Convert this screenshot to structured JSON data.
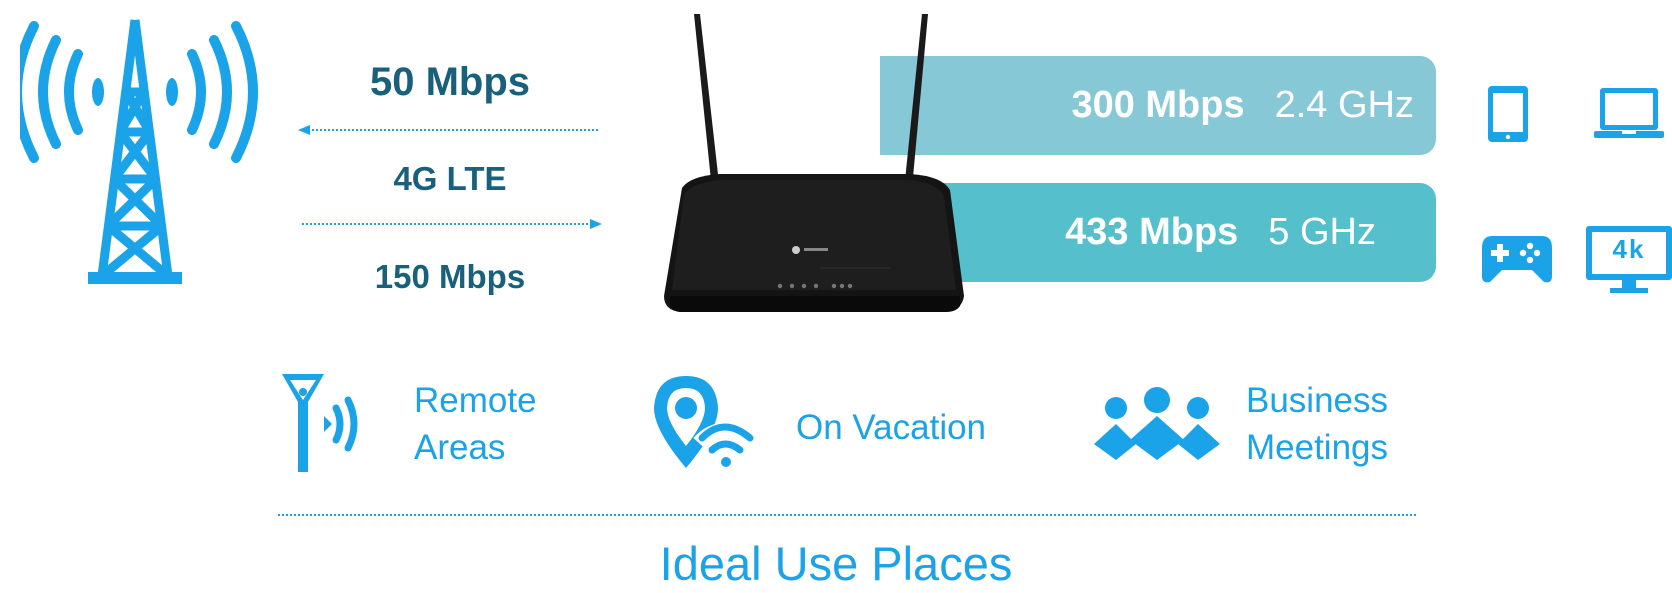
{
  "colors": {
    "accent": "#1aa3e8",
    "dark_text": "#19607c",
    "band_24": "#87c8d6",
    "band_5": "#55bfcc",
    "router": "#141414"
  },
  "lte": {
    "download": "50 Mbps",
    "tech": "4G LTE",
    "upload": "150 Mbps"
  },
  "bands": [
    {
      "rate": "300 Mbps",
      "freq": "2.4 GHz"
    },
    {
      "rate": "433 Mbps",
      "freq": "5 GHz"
    }
  ],
  "devices": {
    "icons": [
      "tablet-icon",
      "laptop-icon",
      "gamepad-icon",
      "monitor-4k-icon"
    ],
    "monitor_label": "4k"
  },
  "places": [
    {
      "icon": "antenna-signal-icon",
      "line1": "Remote",
      "line2": "Areas"
    },
    {
      "icon": "location-wifi-icon",
      "line1": "On Vacation"
    },
    {
      "icon": "people-group-icon",
      "line1": "Business",
      "line2": "Meetings"
    }
  ],
  "footer": {
    "title": "Ideal Use Places"
  }
}
